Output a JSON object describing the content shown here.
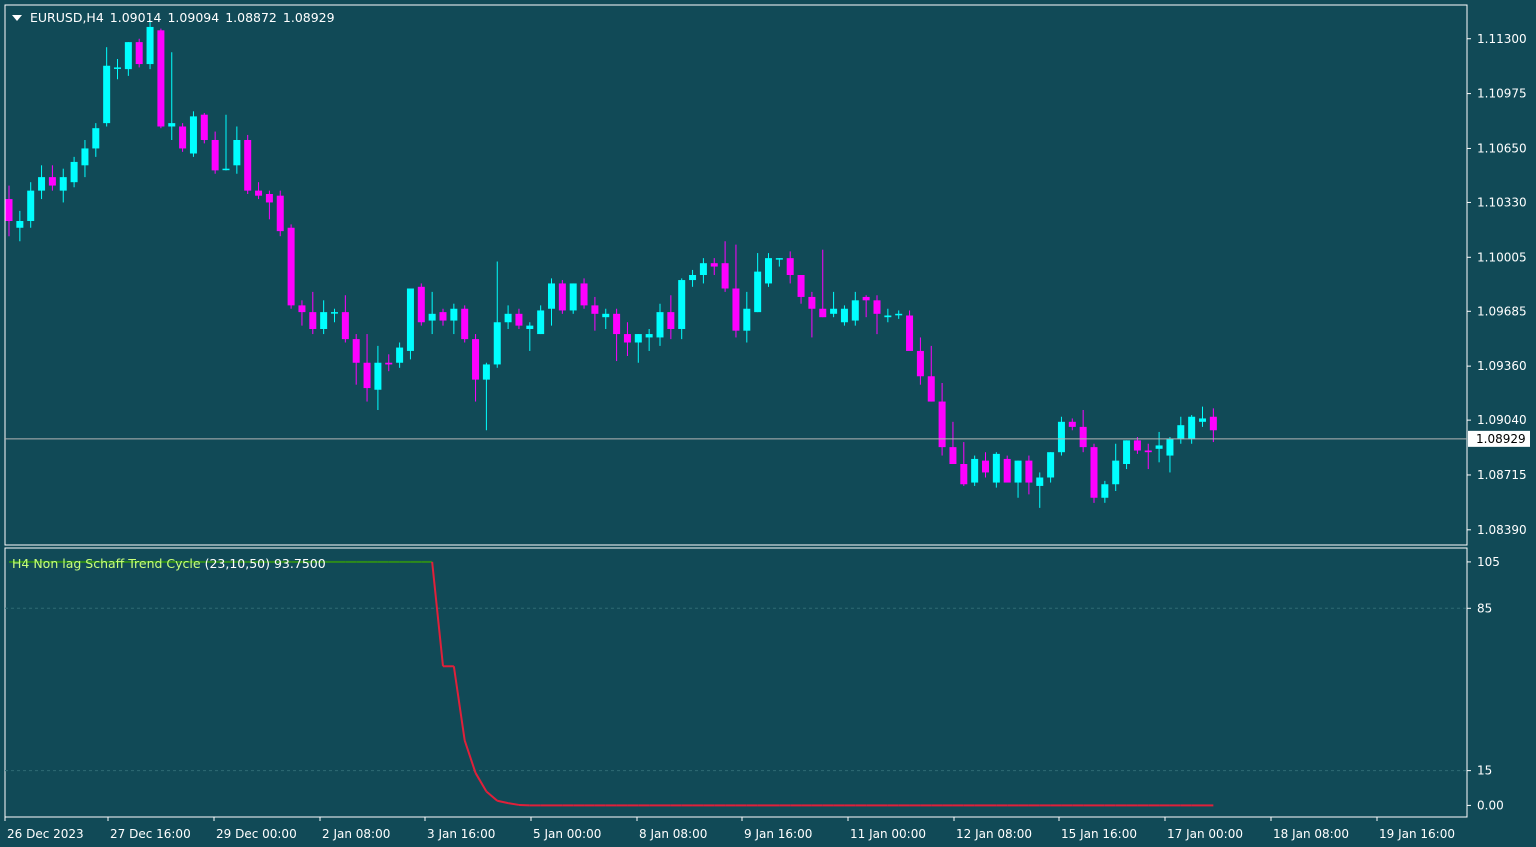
{
  "header": {
    "symbol_tf": "EURUSD,H4",
    "open": "1.09014",
    "high": "1.09094",
    "low": "1.08872",
    "close": "1.08929"
  },
  "current_price_label": "1.08929",
  "indicator": {
    "name": "H4 Non lag Schaff Trend Cycle",
    "params": "(23,10,50)",
    "value": "93.7500",
    "up_color": "#2d8a1c",
    "down_color": "#e0203a"
  },
  "colors": {
    "background": "#114a57",
    "bull": "#00ffff",
    "bear": "#ff00ff",
    "grid_text": "#ffffff",
    "price_line": "#b4b4b4"
  },
  "x_axis_labels": [
    "26 Dec 2023",
    "27 Dec 16:00",
    "29 Dec 00:00",
    "2 Jan 08:00",
    "3 Jan 16:00",
    "5 Jan 00:00",
    "8 Jan 08:00",
    "9 Jan 16:00",
    "11 Jan 00:00",
    "12 Jan 08:00",
    "15 Jan 16:00",
    "17 Jan 00:00",
    "18 Jan 08:00",
    "19 Jan 16:00"
  ],
  "price_axis_labels": [
    "1.11300",
    "1.10975",
    "1.10650",
    "1.10330",
    "1.10005",
    "1.09685",
    "1.09360",
    "1.09040",
    "1.08715",
    "1.08390"
  ],
  "indicator_axis_labels": [
    "105",
    "85",
    "15",
    "0.00"
  ],
  "chart_data": [
    {
      "type": "candlestick",
      "symbol": "EURUSD",
      "timeframe": "H4",
      "ylim": [
        1.083,
        1.115
      ],
      "current_price": 1.08929,
      "candles": [
        {
          "o": 1.1035,
          "h": 1.1043,
          "l": 1.1013,
          "c": 1.1022
        },
        {
          "o": 1.1018,
          "h": 1.1028,
          "l": 1.101,
          "c": 1.1022
        },
        {
          "o": 1.1022,
          "h": 1.1045,
          "l": 1.1018,
          "c": 1.104
        },
        {
          "o": 1.104,
          "h": 1.1055,
          "l": 1.1035,
          "c": 1.1048
        },
        {
          "o": 1.1048,
          "h": 1.1055,
          "l": 1.104,
          "c": 1.1043
        },
        {
          "o": 1.104,
          "h": 1.1053,
          "l": 1.1033,
          "c": 1.1048
        },
        {
          "o": 1.1045,
          "h": 1.106,
          "l": 1.1042,
          "c": 1.1057
        },
        {
          "o": 1.1055,
          "h": 1.107,
          "l": 1.1048,
          "c": 1.1065
        },
        {
          "o": 1.1065,
          "h": 1.108,
          "l": 1.106,
          "c": 1.1077
        },
        {
          "o": 1.108,
          "h": 1.1125,
          "l": 1.1078,
          "c": 1.1114
        },
        {
          "o": 1.1113,
          "h": 1.1118,
          "l": 1.1106,
          "c": 1.1113
        },
        {
          "o": 1.1112,
          "h": 1.1128,
          "l": 1.1108,
          "c": 1.1128
        },
        {
          "o": 1.1128,
          "h": 1.113,
          "l": 1.1113,
          "c": 1.1115
        },
        {
          "o": 1.1115,
          "h": 1.114,
          "l": 1.1112,
          "c": 1.1137
        },
        {
          "o": 1.1135,
          "h": 1.1136,
          "l": 1.1077,
          "c": 1.1078
        },
        {
          "o": 1.1078,
          "h": 1.1122,
          "l": 1.107,
          "c": 1.108
        },
        {
          "o": 1.1078,
          "h": 1.108,
          "l": 1.1063,
          "c": 1.1065
        },
        {
          "o": 1.1062,
          "h": 1.1087,
          "l": 1.106,
          "c": 1.1084
        },
        {
          "o": 1.1085,
          "h": 1.1086,
          "l": 1.1068,
          "c": 1.107
        },
        {
          "o": 1.107,
          "h": 1.1075,
          "l": 1.105,
          "c": 1.1052
        },
        {
          "o": 1.1053,
          "h": 1.1085,
          "l": 1.1052,
          "c": 1.1053
        },
        {
          "o": 1.1055,
          "h": 1.1078,
          "l": 1.105,
          "c": 1.107
        },
        {
          "o": 1.107,
          "h": 1.1073,
          "l": 1.1038,
          "c": 1.104
        },
        {
          "o": 1.104,
          "h": 1.1045,
          "l": 1.1035,
          "c": 1.1037
        },
        {
          "o": 1.1038,
          "h": 1.104,
          "l": 1.1023,
          "c": 1.1033
        },
        {
          "o": 1.1037,
          "h": 1.104,
          "l": 1.1013,
          "c": 1.1016
        },
        {
          "o": 1.1018,
          "h": 1.102,
          "l": 1.097,
          "c": 1.0972
        },
        {
          "o": 1.0972,
          "h": 1.0975,
          "l": 1.096,
          "c": 1.0968
        },
        {
          "o": 1.0968,
          "h": 1.098,
          "l": 1.0955,
          "c": 1.0958
        },
        {
          "o": 1.0958,
          "h": 1.0975,
          "l": 1.0955,
          "c": 1.0968
        },
        {
          "o": 1.0968,
          "h": 1.097,
          "l": 1.0962,
          "c": 1.0968
        },
        {
          "o": 1.0968,
          "h": 1.0978,
          "l": 1.095,
          "c": 1.0952
        },
        {
          "o": 1.0952,
          "h": 1.0955,
          "l": 1.0925,
          "c": 1.0938
        },
        {
          "o": 1.0938,
          "h": 1.0955,
          "l": 1.0915,
          "c": 1.0923
        },
        {
          "o": 1.0922,
          "h": 1.0948,
          "l": 1.091,
          "c": 1.0938
        },
        {
          "o": 1.0938,
          "h": 1.0943,
          "l": 1.0933,
          "c": 1.0937
        },
        {
          "o": 1.0938,
          "h": 1.095,
          "l": 1.0935,
          "c": 1.0947
        },
        {
          "o": 1.0945,
          "h": 1.0982,
          "l": 1.094,
          "c": 1.0982
        },
        {
          "o": 1.0983,
          "h": 1.0985,
          "l": 1.096,
          "c": 1.0962
        },
        {
          "o": 1.0963,
          "h": 1.098,
          "l": 1.0955,
          "c": 1.0967
        },
        {
          "o": 1.0968,
          "h": 1.097,
          "l": 1.096,
          "c": 1.0963
        },
        {
          "o": 1.0963,
          "h": 1.0973,
          "l": 1.0955,
          "c": 1.097
        },
        {
          "o": 1.097,
          "h": 1.0972,
          "l": 1.095,
          "c": 1.0952
        },
        {
          "o": 1.0952,
          "h": 1.0955,
          "l": 1.0915,
          "c": 1.0928
        },
        {
          "o": 1.0928,
          "h": 1.0938,
          "l": 1.0898,
          "c": 1.0937
        },
        {
          "o": 1.0937,
          "h": 1.0998,
          "l": 1.0935,
          "c": 1.0962
        },
        {
          "o": 1.0962,
          "h": 1.0972,
          "l": 1.0958,
          "c": 1.0967
        },
        {
          "o": 1.0967,
          "h": 1.097,
          "l": 1.0958,
          "c": 1.096
        },
        {
          "o": 1.0958,
          "h": 1.0962,
          "l": 1.0945,
          "c": 1.096
        },
        {
          "o": 1.0955,
          "h": 1.0972,
          "l": 1.0955,
          "c": 1.0969
        },
        {
          "o": 1.097,
          "h": 1.0988,
          "l": 1.096,
          "c": 1.0985
        },
        {
          "o": 1.0985,
          "h": 1.0987,
          "l": 1.0967,
          "c": 1.0969
        },
        {
          "o": 1.0969,
          "h": 1.0985,
          "l": 1.0967,
          "c": 1.0985
        },
        {
          "o": 1.0985,
          "h": 1.0988,
          "l": 1.097,
          "c": 1.0972
        },
        {
          "o": 1.0972,
          "h": 1.0977,
          "l": 1.0957,
          "c": 1.0967
        },
        {
          "o": 1.0965,
          "h": 1.097,
          "l": 1.0958,
          "c": 1.0967
        },
        {
          "o": 1.0967,
          "h": 1.097,
          "l": 1.0939,
          "c": 1.0955
        },
        {
          "o": 1.0955,
          "h": 1.0962,
          "l": 1.0942,
          "c": 1.095
        },
        {
          "o": 1.095,
          "h": 1.0955,
          "l": 1.0938,
          "c": 1.0955
        },
        {
          "o": 1.0953,
          "h": 1.0958,
          "l": 1.0945,
          "c": 1.0955
        },
        {
          "o": 1.0953,
          "h": 1.0973,
          "l": 1.0948,
          "c": 1.0968
        },
        {
          "o": 1.0968,
          "h": 1.0978,
          "l": 1.0952,
          "c": 1.0958
        },
        {
          "o": 1.0958,
          "h": 1.0988,
          "l": 1.0952,
          "c": 1.0987
        },
        {
          "o": 1.0987,
          "h": 1.0993,
          "l": 1.0983,
          "c": 1.099
        },
        {
          "o": 1.099,
          "h": 1.1,
          "l": 1.0985,
          "c": 1.0997
        },
        {
          "o": 1.0997,
          "h": 1.1,
          "l": 1.099,
          "c": 1.0995
        },
        {
          "o": 1.0997,
          "h": 1.101,
          "l": 1.098,
          "c": 1.0982
        },
        {
          "o": 1.0982,
          "h": 1.1008,
          "l": 1.0953,
          "c": 1.0957
        },
        {
          "o": 1.0957,
          "h": 1.098,
          "l": 1.095,
          "c": 1.097
        },
        {
          "o": 1.0968,
          "h": 1.1003,
          "l": 1.0968,
          "c": 1.0992
        },
        {
          "o": 1.0985,
          "h": 1.1003,
          "l": 1.0983,
          "c": 1.1
        },
        {
          "o": 1.1,
          "h": 1.1,
          "l": 1.0995,
          "c": 1.1
        },
        {
          "o": 1.1,
          "h": 1.1004,
          "l": 1.0985,
          "c": 1.099
        },
        {
          "o": 1.099,
          "h": 1.099,
          "l": 1.0973,
          "c": 1.0977
        },
        {
          "o": 1.0977,
          "h": 1.098,
          "l": 1.0953,
          "c": 1.097
        },
        {
          "o": 1.097,
          "h": 1.1005,
          "l": 1.0965,
          "c": 1.0965
        },
        {
          "o": 1.0967,
          "h": 1.098,
          "l": 1.0965,
          "c": 1.097
        },
        {
          "o": 1.0962,
          "h": 1.0972,
          "l": 1.096,
          "c": 1.097
        },
        {
          "o": 1.0963,
          "h": 1.098,
          "l": 1.096,
          "c": 1.0975
        },
        {
          "o": 1.0977,
          "h": 1.0978,
          "l": 1.0965,
          "c": 1.0975
        },
        {
          "o": 1.0975,
          "h": 1.0978,
          "l": 1.0955,
          "c": 1.0967
        },
        {
          "o": 1.0965,
          "h": 1.097,
          "l": 1.0962,
          "c": 1.0966
        },
        {
          "o": 1.0967,
          "h": 1.0969,
          "l": 1.0964,
          "c": 1.0967
        },
        {
          "o": 1.0966,
          "h": 1.0969,
          "l": 1.0947,
          "c": 1.0945
        },
        {
          "o": 1.0945,
          "h": 1.0953,
          "l": 1.0925,
          "c": 1.093
        },
        {
          "o": 1.093,
          "h": 1.0948,
          "l": 1.0915,
          "c": 1.0915
        },
        {
          "o": 1.0915,
          "h": 1.0926,
          "l": 1.0883,
          "c": 1.0888
        },
        {
          "o": 1.0888,
          "h": 1.0903,
          "l": 1.088,
          "c": 1.0878
        },
        {
          "o": 1.0878,
          "h": 1.0891,
          "l": 1.0865,
          "c": 1.0866
        },
        {
          "o": 1.0867,
          "h": 1.0883,
          "l": 1.0865,
          "c": 1.0881
        },
        {
          "o": 1.088,
          "h": 1.0885,
          "l": 1.087,
          "c": 1.0873
        },
        {
          "o": 1.0867,
          "h": 1.0885,
          "l": 1.0864,
          "c": 1.0884
        },
        {
          "o": 1.0881,
          "h": 1.0883,
          "l": 1.0868,
          "c": 1.0867
        },
        {
          "o": 1.0867,
          "h": 1.088,
          "l": 1.0858,
          "c": 1.088
        },
        {
          "o": 1.088,
          "h": 1.0883,
          "l": 1.086,
          "c": 1.0867
        },
        {
          "o": 1.0865,
          "h": 1.0873,
          "l": 1.0852,
          "c": 1.087
        },
        {
          "o": 1.087,
          "h": 1.0885,
          "l": 1.0867,
          "c": 1.0885
        },
        {
          "o": 1.0885,
          "h": 1.0906,
          "l": 1.0883,
          "c": 1.0903
        },
        {
          "o": 1.0903,
          "h": 1.0905,
          "l": 1.0898,
          "c": 1.09
        },
        {
          "o": 1.09,
          "h": 1.091,
          "l": 1.0885,
          "c": 1.0888
        },
        {
          "o": 1.0888,
          "h": 1.089,
          "l": 1.0855,
          "c": 1.0858
        },
        {
          "o": 1.0858,
          "h": 1.0868,
          "l": 1.0855,
          "c": 1.0866
        },
        {
          "o": 1.0866,
          "h": 1.089,
          "l": 1.0862,
          "c": 1.088
        },
        {
          "o": 1.0878,
          "h": 1.0892,
          "l": 1.0875,
          "c": 1.0892
        },
        {
          "o": 1.0892,
          "h": 1.0894,
          "l": 1.0884,
          "c": 1.0886
        },
        {
          "o": 1.0886,
          "h": 1.089,
          "l": 1.0875,
          "c": 1.0885
        },
        {
          "o": 1.0887,
          "h": 1.0897,
          "l": 1.0879,
          "c": 1.0889
        },
        {
          "o": 1.0883,
          "h": 1.0894,
          "l": 1.0873,
          "c": 1.0893
        },
        {
          "o": 1.0893,
          "h": 1.0906,
          "l": 1.089,
          "c": 1.0901
        },
        {
          "o": 1.0893,
          "h": 1.0907,
          "l": 1.089,
          "c": 1.0906
        },
        {
          "o": 1.0903,
          "h": 1.0912,
          "l": 1.09,
          "c": 1.0905
        },
        {
          "o": 1.0906,
          "h": 1.0911,
          "l": 1.0891,
          "c": 1.0898
        }
      ]
    },
    {
      "type": "line",
      "name": "H4 Non lag Schaff Trend Cycle",
      "ylim": [
        -5,
        111
      ],
      "levels": [
        85,
        15
      ],
      "values": [
        105,
        105,
        105,
        105,
        105,
        105,
        105,
        105,
        105,
        105,
        105,
        105,
        105,
        105,
        105,
        105,
        105,
        105,
        105,
        105,
        105,
        105,
        105,
        105,
        105,
        105,
        105,
        105,
        105,
        105,
        105,
        105,
        105,
        105,
        105,
        105,
        105,
        105,
        105,
        105,
        60,
        60,
        28,
        14,
        6,
        2,
        1,
        0.2,
        0,
        0,
        0,
        0,
        0,
        0,
        0,
        0,
        0,
        0,
        0,
        0,
        0,
        0,
        0,
        0,
        0,
        0,
        0,
        0,
        0,
        0,
        0,
        0,
        0,
        0,
        0,
        0,
        0,
        0,
        0,
        0,
        0,
        0,
        0,
        0,
        0,
        0,
        0,
        0,
        0,
        0,
        0,
        0,
        0,
        0,
        0,
        0,
        0,
        0,
        0,
        0,
        0,
        0,
        0,
        0,
        0,
        0,
        0,
        0,
        0,
        0,
        0,
        0
      ],
      "colors": [
        "up",
        "up",
        "up",
        "up",
        "up",
        "up",
        "up",
        "up",
        "up",
        "up",
        "up",
        "up",
        "up",
        "up",
        "up",
        "up",
        "up",
        "up",
        "up",
        "up",
        "up",
        "up",
        "up",
        "up",
        "up",
        "up",
        "up",
        "up",
        "up",
        "up",
        "up",
        "up",
        "up",
        "up",
        "up",
        "up",
        "up",
        "up",
        "up",
        "up",
        "down",
        "down",
        "down",
        "down",
        "down",
        "down",
        "down",
        "down",
        "down",
        "down",
        "down",
        "down",
        "down",
        "down",
        "down",
        "down",
        "down",
        "down",
        "down",
        "down",
        "down",
        "down",
        "down",
        "down",
        "down",
        "down",
        "down",
        "down",
        "down",
        "down",
        "down",
        "down",
        "down",
        "down",
        "down",
        "down",
        "down",
        "down",
        "down",
        "down",
        "down",
        "down",
        "down",
        "down",
        "down",
        "down",
        "down",
        "down",
        "down",
        "down",
        "down",
        "down",
        "down",
        "down",
        "down",
        "down",
        "down",
        "down",
        "down",
        "down",
        "down",
        "down",
        "down",
        "down",
        "down",
        "down",
        "down",
        "down",
        "down",
        "down",
        "down",
        "down"
      ]
    }
  ]
}
